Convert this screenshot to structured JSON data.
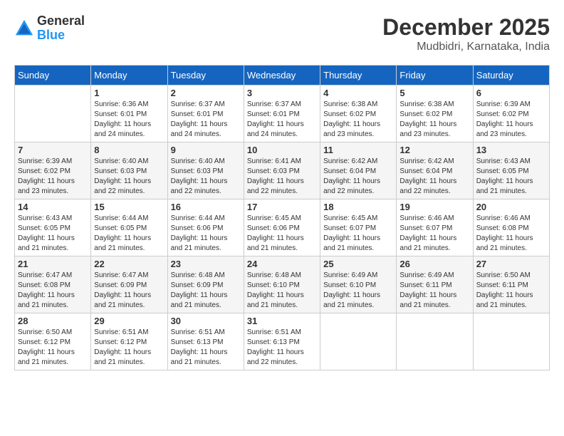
{
  "header": {
    "logo": {
      "general": "General",
      "blue": "Blue"
    },
    "title": "December 2025",
    "location": "Mudbidri, Karnataka, India"
  },
  "days_of_week": [
    "Sunday",
    "Monday",
    "Tuesday",
    "Wednesday",
    "Thursday",
    "Friday",
    "Saturday"
  ],
  "weeks": [
    [
      {
        "day": "",
        "info": ""
      },
      {
        "day": "1",
        "sunrise": "Sunrise: 6:36 AM",
        "sunset": "Sunset: 6:01 PM",
        "daylight": "Daylight: 11 hours and 24 minutes."
      },
      {
        "day": "2",
        "sunrise": "Sunrise: 6:37 AM",
        "sunset": "Sunset: 6:01 PM",
        "daylight": "Daylight: 11 hours and 24 minutes."
      },
      {
        "day": "3",
        "sunrise": "Sunrise: 6:37 AM",
        "sunset": "Sunset: 6:01 PM",
        "daylight": "Daylight: 11 hours and 24 minutes."
      },
      {
        "day": "4",
        "sunrise": "Sunrise: 6:38 AM",
        "sunset": "Sunset: 6:02 PM",
        "daylight": "Daylight: 11 hours and 23 minutes."
      },
      {
        "day": "5",
        "sunrise": "Sunrise: 6:38 AM",
        "sunset": "Sunset: 6:02 PM",
        "daylight": "Daylight: 11 hours and 23 minutes."
      },
      {
        "day": "6",
        "sunrise": "Sunrise: 6:39 AM",
        "sunset": "Sunset: 6:02 PM",
        "daylight": "Daylight: 11 hours and 23 minutes."
      }
    ],
    [
      {
        "day": "7",
        "sunrise": "Sunrise: 6:39 AM",
        "sunset": "Sunset: 6:02 PM",
        "daylight": "Daylight: 11 hours and 23 minutes."
      },
      {
        "day": "8",
        "sunrise": "Sunrise: 6:40 AM",
        "sunset": "Sunset: 6:03 PM",
        "daylight": "Daylight: 11 hours and 22 minutes."
      },
      {
        "day": "9",
        "sunrise": "Sunrise: 6:40 AM",
        "sunset": "Sunset: 6:03 PM",
        "daylight": "Daylight: 11 hours and 22 minutes."
      },
      {
        "day": "10",
        "sunrise": "Sunrise: 6:41 AM",
        "sunset": "Sunset: 6:03 PM",
        "daylight": "Daylight: 11 hours and 22 minutes."
      },
      {
        "day": "11",
        "sunrise": "Sunrise: 6:42 AM",
        "sunset": "Sunset: 6:04 PM",
        "daylight": "Daylight: 11 hours and 22 minutes."
      },
      {
        "day": "12",
        "sunrise": "Sunrise: 6:42 AM",
        "sunset": "Sunset: 6:04 PM",
        "daylight": "Daylight: 11 hours and 22 minutes."
      },
      {
        "day": "13",
        "sunrise": "Sunrise: 6:43 AM",
        "sunset": "Sunset: 6:05 PM",
        "daylight": "Daylight: 11 hours and 21 minutes."
      }
    ],
    [
      {
        "day": "14",
        "sunrise": "Sunrise: 6:43 AM",
        "sunset": "Sunset: 6:05 PM",
        "daylight": "Daylight: 11 hours and 21 minutes."
      },
      {
        "day": "15",
        "sunrise": "Sunrise: 6:44 AM",
        "sunset": "Sunset: 6:05 PM",
        "daylight": "Daylight: 11 hours and 21 minutes."
      },
      {
        "day": "16",
        "sunrise": "Sunrise: 6:44 AM",
        "sunset": "Sunset: 6:06 PM",
        "daylight": "Daylight: 11 hours and 21 minutes."
      },
      {
        "day": "17",
        "sunrise": "Sunrise: 6:45 AM",
        "sunset": "Sunset: 6:06 PM",
        "daylight": "Daylight: 11 hours and 21 minutes."
      },
      {
        "day": "18",
        "sunrise": "Sunrise: 6:45 AM",
        "sunset": "Sunset: 6:07 PM",
        "daylight": "Daylight: 11 hours and 21 minutes."
      },
      {
        "day": "19",
        "sunrise": "Sunrise: 6:46 AM",
        "sunset": "Sunset: 6:07 PM",
        "daylight": "Daylight: 11 hours and 21 minutes."
      },
      {
        "day": "20",
        "sunrise": "Sunrise: 6:46 AM",
        "sunset": "Sunset: 6:08 PM",
        "daylight": "Daylight: 11 hours and 21 minutes."
      }
    ],
    [
      {
        "day": "21",
        "sunrise": "Sunrise: 6:47 AM",
        "sunset": "Sunset: 6:08 PM",
        "daylight": "Daylight: 11 hours and 21 minutes."
      },
      {
        "day": "22",
        "sunrise": "Sunrise: 6:47 AM",
        "sunset": "Sunset: 6:09 PM",
        "daylight": "Daylight: 11 hours and 21 minutes."
      },
      {
        "day": "23",
        "sunrise": "Sunrise: 6:48 AM",
        "sunset": "Sunset: 6:09 PM",
        "daylight": "Daylight: 11 hours and 21 minutes."
      },
      {
        "day": "24",
        "sunrise": "Sunrise: 6:48 AM",
        "sunset": "Sunset: 6:10 PM",
        "daylight": "Daylight: 11 hours and 21 minutes."
      },
      {
        "day": "25",
        "sunrise": "Sunrise: 6:49 AM",
        "sunset": "Sunset: 6:10 PM",
        "daylight": "Daylight: 11 hours and 21 minutes."
      },
      {
        "day": "26",
        "sunrise": "Sunrise: 6:49 AM",
        "sunset": "Sunset: 6:11 PM",
        "daylight": "Daylight: 11 hours and 21 minutes."
      },
      {
        "day": "27",
        "sunrise": "Sunrise: 6:50 AM",
        "sunset": "Sunset: 6:11 PM",
        "daylight": "Daylight: 11 hours and 21 minutes."
      }
    ],
    [
      {
        "day": "28",
        "sunrise": "Sunrise: 6:50 AM",
        "sunset": "Sunset: 6:12 PM",
        "daylight": "Daylight: 11 hours and 21 minutes."
      },
      {
        "day": "29",
        "sunrise": "Sunrise: 6:51 AM",
        "sunset": "Sunset: 6:12 PM",
        "daylight": "Daylight: 11 hours and 21 minutes."
      },
      {
        "day": "30",
        "sunrise": "Sunrise: 6:51 AM",
        "sunset": "Sunset: 6:13 PM",
        "daylight": "Daylight: 11 hours and 21 minutes."
      },
      {
        "day": "31",
        "sunrise": "Sunrise: 6:51 AM",
        "sunset": "Sunset: 6:13 PM",
        "daylight": "Daylight: 11 hours and 22 minutes."
      },
      {
        "day": "",
        "info": ""
      },
      {
        "day": "",
        "info": ""
      },
      {
        "day": "",
        "info": ""
      }
    ]
  ]
}
